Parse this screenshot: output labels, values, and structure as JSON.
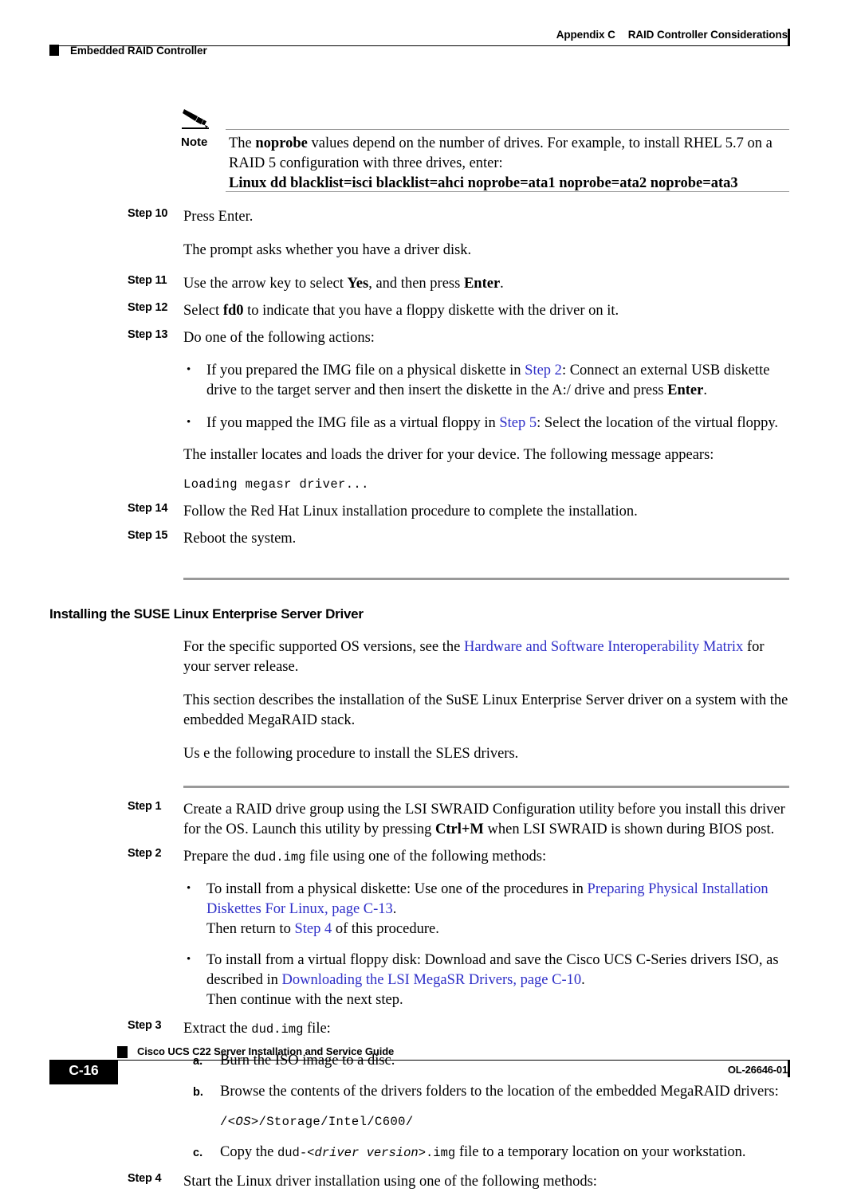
{
  "header": {
    "appendix": "Appendix C",
    "appendix_title": "RAID Controller Considerations",
    "running_head": "Embedded RAID Controller"
  },
  "note": {
    "icon": "pencil-icon",
    "label": "Note",
    "text": "The ",
    "bold_term": "noprobe",
    "text2": " values depend on the number of drives. For example, to install RHEL 5.7 on a RAID 5 configuration with three drives, enter:",
    "command": "Linux dd blacklist=isci blacklist=ahci noprobe=ata1 noprobe=ata2 noprobe=ata3"
  },
  "rhel_steps": [
    {
      "label": "Step 10",
      "text": "Press Enter."
    },
    {
      "label": "",
      "text": "The prompt asks whether you have a driver disk."
    },
    {
      "label": "Step 11",
      "pre": "Use the arrow key to select ",
      "bold1": "Yes",
      "mid": ", and then press ",
      "bold2": "Enter",
      "post": "."
    },
    {
      "label": "Step 12",
      "pre": "Select ",
      "bold1": "fd0",
      "post": " to indicate that you have a floppy diskette with the driver on it."
    },
    {
      "label": "Step 13",
      "text": "Do one of the following actions:"
    }
  ],
  "rhel_bullets": [
    {
      "pre": "If you prepared the IMG file on a physical diskette in ",
      "xref": "Step 2",
      "mid": ": Connect an external USB diskette drive to the target server and then insert the diskette in the A:/ drive and press ",
      "bold": "Enter",
      "post": "."
    },
    {
      "pre": "If you mapped the IMG file as a virtual floppy in ",
      "xref": "Step 5",
      "mid": ": Select the location of the virtual floppy.",
      "bold": "",
      "post": ""
    }
  ],
  "installer_message_intro": "The installer locates and loads the driver for your device. The following message appears:",
  "installer_message_code": "Loading megasr driver...",
  "rhel_steps_tail": [
    {
      "label": "Step 14",
      "text": "Follow the Red Hat Linux installation procedure to complete the installation."
    },
    {
      "label": "Step 15",
      "text": "Reboot the system."
    }
  ],
  "section": {
    "heading": "Installing the SUSE Linux Enterprise Server Driver",
    "intro_pre": "For the specific supported OS versions, see the ",
    "intro_link": "Hardware and Software Interoperability Matrix",
    "intro_post": " for your server release.",
    "para2": "This section describes the installation of the SuSE Linux Enterprise Server driver on a system with the embedded MegaRAID stack.",
    "para3": "Us e the following procedure to install the SLES drivers."
  },
  "sles_steps": {
    "step1": {
      "label": "Step 1",
      "pre": "Create a RAID drive group using the LSI SWRAID Configuration utility before you install this driver for the OS. Launch this utility by pressing ",
      "bold": "Ctrl+M",
      "post": " when LSI SWRAID is shown during BIOS post."
    },
    "step2": {
      "label": "Step 2",
      "pre": "Prepare the ",
      "mono": "dud.img",
      "post": " file using one of the following methods:"
    },
    "step2_bullets": [
      {
        "pre": "To install from a physical diskette: Use one of the procedures in ",
        "link": "Preparing Physical Installation Diskettes For Linux, page C-13",
        "mid": ".",
        "tail_pre": "Then return to ",
        "tail_link": "Step 4",
        "tail_post": " of this procedure."
      },
      {
        "pre": "To install from a virtual floppy disk: Download and save the Cisco UCS C-Series drivers ISO, as described in ",
        "link": "Downloading the LSI MegaSR Drivers, page C-10",
        "mid": ".",
        "tail_pre": "Then continue with the next step.",
        "tail_link": "",
        "tail_post": ""
      }
    ],
    "step3": {
      "label": "Step 3",
      "pre": "Extract the ",
      "mono": "dud.img",
      "post": " file:"
    },
    "step3_subs": [
      {
        "letter": "a.",
        "text": "Burn the ISO image to a disc."
      },
      {
        "letter": "b.",
        "text": "Browse the contents of the drivers folders to the location of the embedded MegaRAID drivers:",
        "code_pre": "/<",
        "code_ital": "OS",
        "code_post": ">/Storage/Intel/C600/"
      },
      {
        "letter": "c.",
        "pre": "Copy the ",
        "mono": "dud-",
        "mono_ital": "<driver version>",
        "mono2": ".img",
        "post": " file to a temporary location on your workstation."
      }
    ],
    "step4": {
      "label": "Step 4",
      "text": "Start the Linux driver installation using one of the following methods:"
    }
  },
  "footer": {
    "guide_title": "Cisco UCS C22 Server Installation and Service Guide",
    "page_number": "C-16",
    "doc_id": "OL-26646-01"
  },
  "colors": {
    "link": "#2f2fc8",
    "rule_gray": "#9a9a9a",
    "ink": "#000000"
  }
}
